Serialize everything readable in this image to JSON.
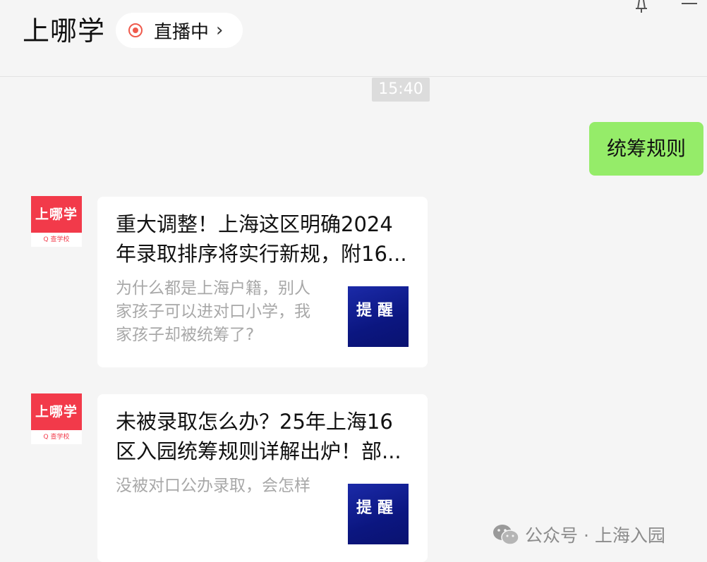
{
  "header": {
    "title": "上哪学",
    "live_label": "直播中",
    "live_chevron": "›"
  },
  "chat": {
    "timestamp": "15:40",
    "outgoing_message": "统筹规则",
    "articles": [
      {
        "avatar_brand": "上哪学",
        "avatar_sub": "Q 查学校",
        "title_line1": "重大调整！上海这区明确2024",
        "title_line2": "年录取排序将实行新规，附16...",
        "desc_line1": "为什么都是上海户籍，别人",
        "desc_line2": "家孩子可以进对口小学，我",
        "desc_line3": "家孩子却被统筹了?",
        "thumb_text": "提醒"
      },
      {
        "avatar_brand": "上哪学",
        "avatar_sub": "Q 查学校",
        "title_line1": "未被录取怎么办？25年上海16",
        "title_line2": "区入园统筹规则详解出炉！部...",
        "desc_line1": "没被对口公办录取，会怎样",
        "thumb_text": "提醒"
      }
    ]
  },
  "watermark": {
    "text": "公众号 · 上海入园"
  },
  "colors": {
    "outgoing_bubble": "#95ec69",
    "brand_red": "#f23a4a",
    "live_dot": "#ef5a4c",
    "thumb_blue": "#0b1680"
  }
}
